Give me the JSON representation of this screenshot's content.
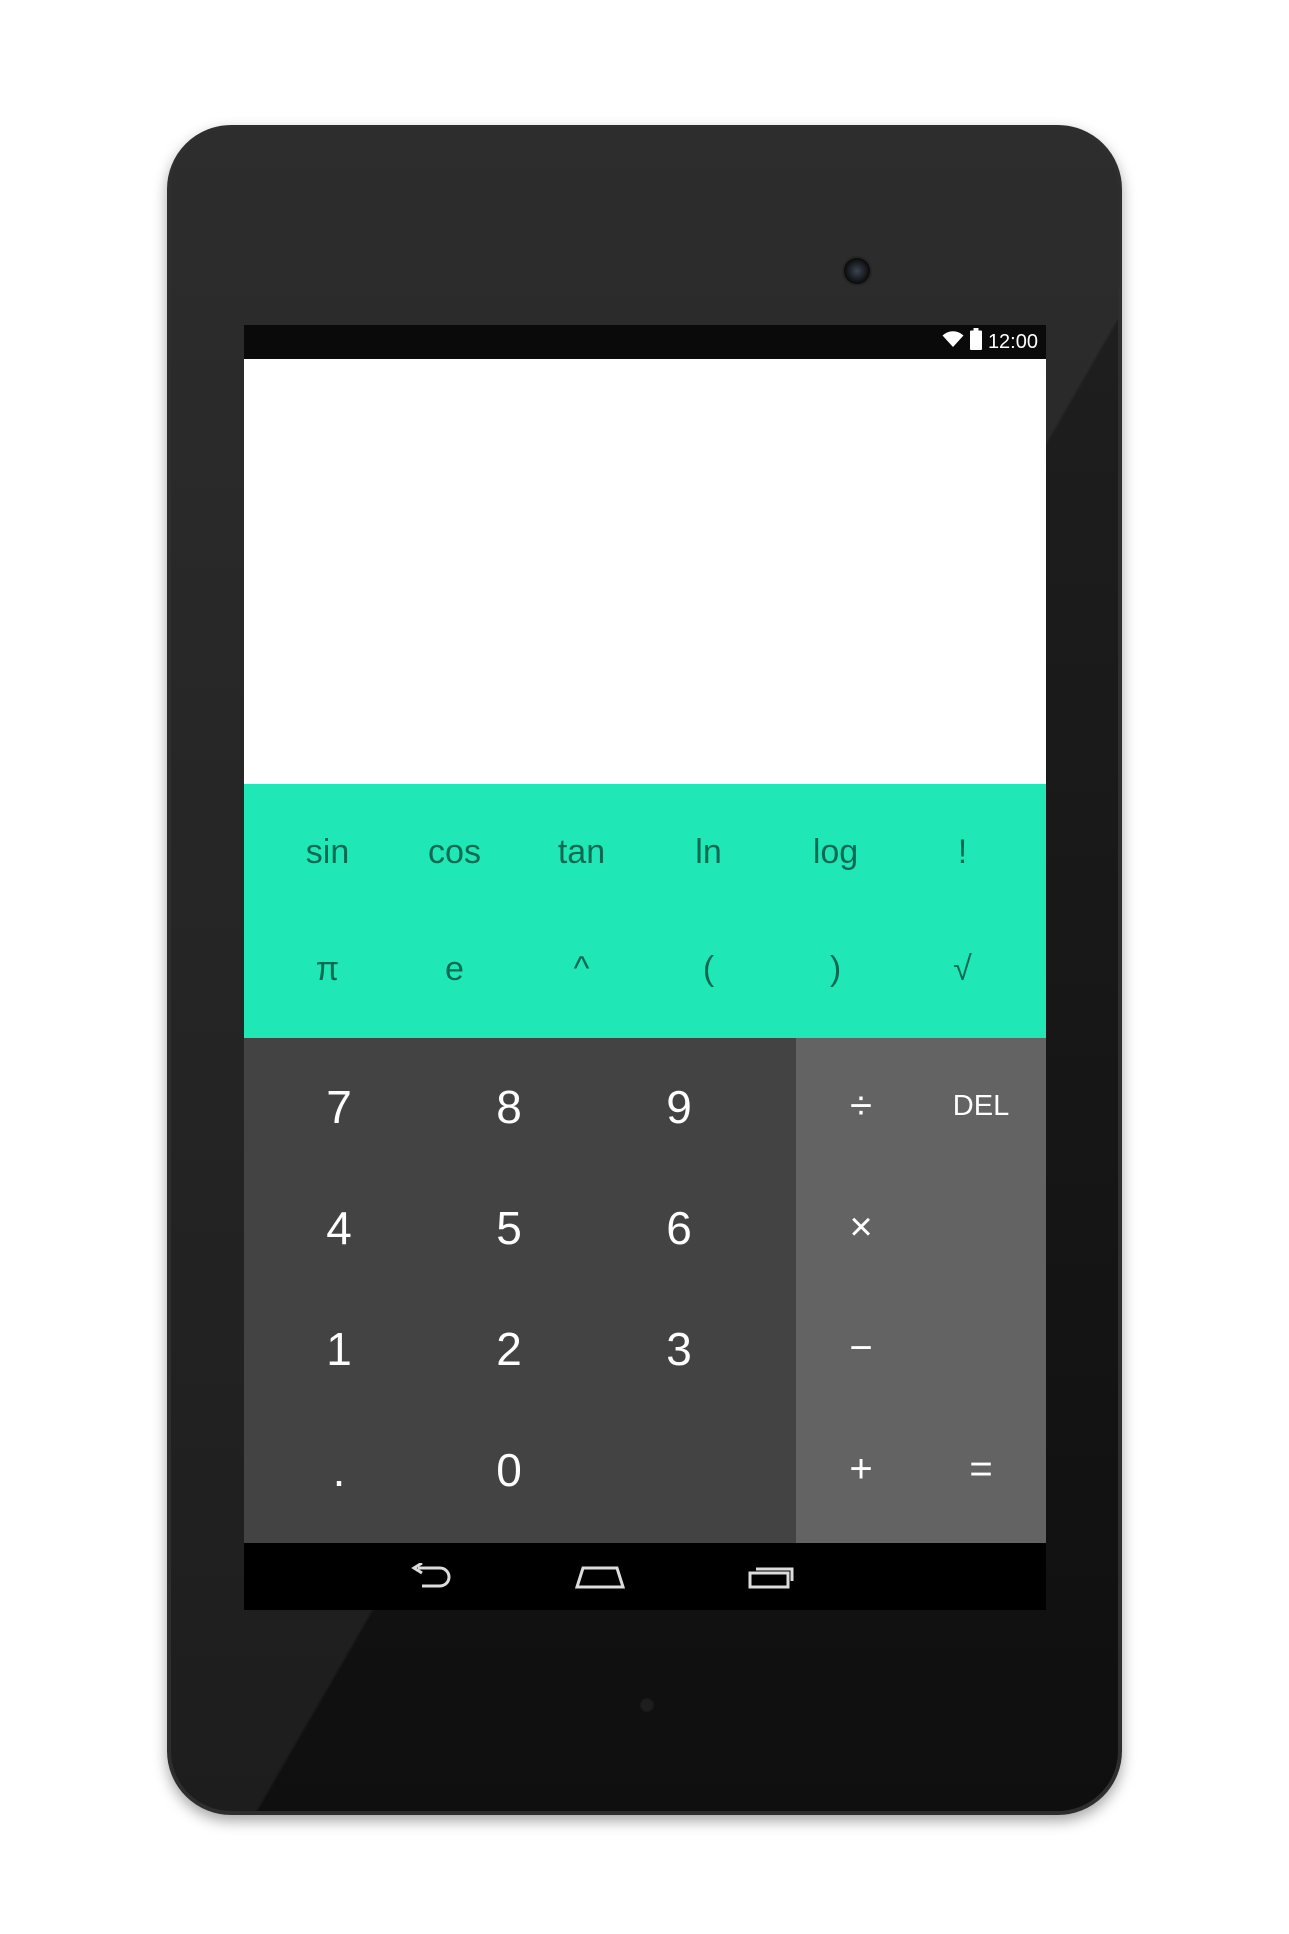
{
  "status_bar": {
    "time": "12:00",
    "icons": [
      "wifi-icon",
      "battery-icon"
    ]
  },
  "display": {
    "formula": "",
    "result": ""
  },
  "advanced_pad": {
    "keys": [
      "sin",
      "cos",
      "tan",
      "ln",
      "log",
      "!",
      "π",
      "e",
      "^",
      "(",
      ")",
      "√"
    ]
  },
  "numeric_pad": {
    "keys": [
      "7",
      "8",
      "9",
      "4",
      "5",
      "6",
      "1",
      "2",
      "3",
      ".",
      "0",
      ""
    ]
  },
  "operator_pad": {
    "keys": [
      "÷",
      "DEL",
      "×",
      "",
      "−",
      "",
      "+",
      "="
    ]
  },
  "nav_bar": {
    "icons": [
      "back-icon",
      "home-icon",
      "recents-icon"
    ]
  },
  "colors": {
    "accent_teal": "#1fe8b6",
    "numpad_bg": "#434343",
    "operator_bg": "#636363",
    "display_bg": "#ffffff"
  }
}
